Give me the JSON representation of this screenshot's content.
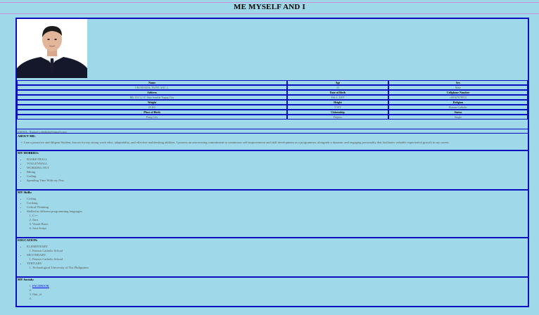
{
  "page": {
    "title": "ME MYSELF AND I"
  },
  "profile": {
    "headers_row1": [
      "Name",
      "Age",
      "Sex"
    ],
    "values_row1": [
      "CELEDADA, FLINT AXL L.",
      "15",
      "Male"
    ],
    "headers_row2": [
      "Address",
      "Date of Birth",
      "Cellphone Number"
    ],
    "values_row2": [
      "Blk 131 Lt 1C Sitio Imelda Tugug City",
      "Feb 1, 2007",
      "+09167678912"
    ],
    "headers_row3": [
      "Weight",
      "Height",
      "Religion"
    ],
    "values_row3": [
      "45 KG",
      "5'1FT",
      "Roman Catholic"
    ],
    "headers_row4": [
      "Place of Birth",
      "Citizenship",
      "Status"
    ],
    "values_row4": [
      "Pasig City",
      "Filipino",
      "Single"
    ],
    "email": "EMAIL: flintaxl.celedada@gmail.com"
  },
  "about": {
    "heading": "ABOUT ME:",
    "text": "I am a proactive and diligent Student, known for my strong work ethic, adaptability, and effective multitasking abilities. I possess an unwavering commitment to continuous self-improvement and skill development as a programmer, alongside a dynamic and engaging personality that facilitates valuable experiential growth in my career."
  },
  "hobbies": {
    "heading": "MY HOBBIES:",
    "items": [
      "BASKETBALL",
      "VOLLEYBALL",
      "WORKING OUT",
      "Biking",
      "Coding",
      "Spending Time With my Pets"
    ]
  },
  "skills": {
    "heading": "MY Skills:",
    "items": [
      "Coding",
      "Cooking",
      "Critical Thinking",
      "Skilled in different programming languages"
    ],
    "languages": [
      "C++",
      "Java",
      "Visual Basic",
      "Java Script"
    ]
  },
  "education": {
    "heading": "EDUCATION:",
    "levels": [
      {
        "label": "ELEMENTARY",
        "school": "Pateros Catholic School"
      },
      {
        "label": "SECONDARY",
        "school": "Pateros Catholic School"
      },
      {
        "label": "TERTIARY",
        "school": "Technological University of The Philippines"
      }
    ]
  },
  "socials": {
    "heading": "MY Socials:",
    "items": [
      "FACEBOOK",
      "",
      "flint_xl",
      ""
    ]
  }
}
